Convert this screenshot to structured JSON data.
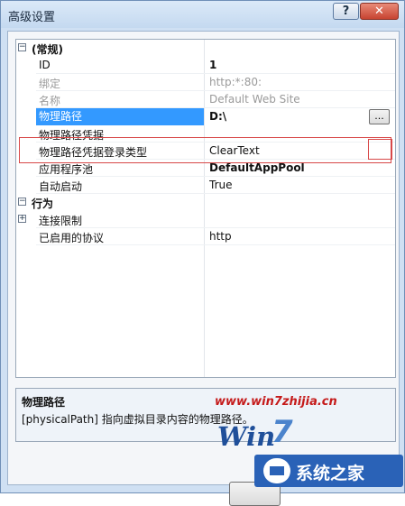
{
  "window": {
    "title": "高级设置"
  },
  "grid": {
    "general": {
      "label": "(常规)",
      "expander": "⊟"
    },
    "rows_general": [
      {
        "name": "ID",
        "value": "1"
      },
      {
        "name": "绑定",
        "value": "http:*:80:"
      },
      {
        "name": "名称",
        "value": "Default Web Site"
      },
      {
        "name": "物理路径",
        "value": "D:\\",
        "button": "..."
      },
      {
        "name": "物理路径凭据",
        "value": ""
      },
      {
        "name": "物理路径凭据登录类型",
        "value": "ClearText"
      },
      {
        "name": "应用程序池",
        "value": "DefaultAppPool"
      },
      {
        "name": "自动启动",
        "value": "True"
      }
    ],
    "behavior": {
      "label": "行为",
      "expander": "⊟"
    },
    "rows_behavior": [
      {
        "name": "连接限制",
        "value": "",
        "expander": "⊞"
      },
      {
        "name": "已启用的协议",
        "value": "http"
      }
    ]
  },
  "description": {
    "title": "物理路径",
    "text": "[physicalPath] 指向虚拟目录内容的物理路径。"
  },
  "watermark": {
    "url": "www.win7zhijia.cn",
    "logo_win": "Win",
    "logo_7": "7",
    "site": "系统之家"
  }
}
